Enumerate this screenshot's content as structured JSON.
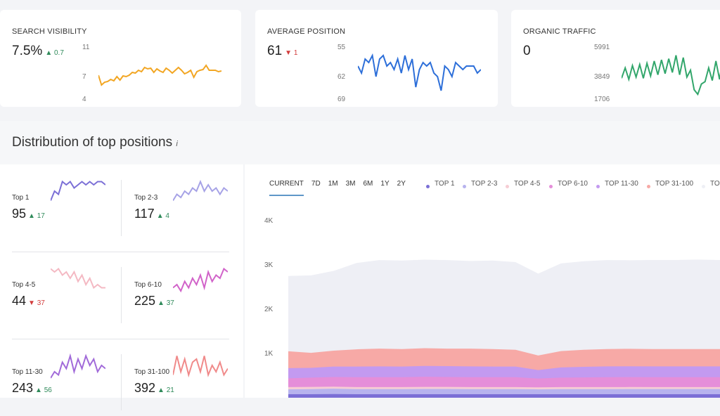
{
  "cards": [
    {
      "title": "SEARCH VISIBILITY",
      "value": "7.5%",
      "delta": "0.7",
      "dir": "up",
      "axis": [
        "11",
        "7",
        "4"
      ],
      "color": "#f2a623",
      "range": [
        4,
        11
      ],
      "values": [
        7.2,
        5.8,
        6.2,
        6.3,
        6.6,
        6.4,
        7.0,
        6.5,
        7.1,
        7.0,
        7.2,
        7.6,
        7.5,
        7.9,
        7.7,
        8.3,
        8.1,
        8.2,
        7.6,
        8.1,
        7.8,
        7.6,
        8.2,
        7.9,
        7.5,
        7.9,
        8.3,
        7.9,
        7.4,
        7.6,
        7.9,
        6.9,
        7.7,
        7.9,
        8.0,
        8.6,
        7.9,
        7.9,
        7.9,
        7.7,
        7.8
      ]
    },
    {
      "title": "AVERAGE POSITION",
      "value": "61",
      "delta": "1",
      "dir": "down",
      "axis": [
        "55",
        "62",
        "69"
      ],
      "color": "#2d6fd9",
      "range": [
        55,
        69
      ],
      "values": [
        60,
        62,
        58,
        59,
        57,
        63,
        58,
        57,
        60,
        59,
        61,
        58,
        62,
        57,
        61,
        58,
        66,
        61,
        59,
        60,
        59,
        62,
        63,
        67,
        60,
        61,
        63,
        59,
        60,
        61,
        60,
        60,
        60,
        62,
        61
      ]
    },
    {
      "title": "ORGANIC TRAFFIC",
      "value": "0",
      "axis": [
        "5991",
        "3849",
        "1706"
      ],
      "color": "#32a66b",
      "range": [
        1706,
        5991
      ],
      "values": [
        3400,
        4300,
        3300,
        4500,
        3500,
        4600,
        3400,
        4700,
        3600,
        4900,
        3700,
        5000,
        3800,
        5100,
        3900,
        5400,
        3700,
        5200,
        3500,
        4100,
        2400,
        2000,
        2900,
        3100,
        4300,
        3200,
        4900,
        3300,
        5200,
        3400,
        5300,
        3500
      ]
    }
  ],
  "section": {
    "title": "Distribution of top positions",
    "info": "i"
  },
  "tiles": [
    {
      "label": "Top 1",
      "value": "95",
      "delta": "17",
      "dir": "up",
      "color": "#7b6fd6",
      "values": [
        3,
        6,
        5,
        9,
        8,
        9,
        7,
        8,
        9,
        8,
        9,
        8,
        9,
        9,
        8
      ]
    },
    {
      "label": "Top 2-3",
      "value": "117",
      "delta": "4",
      "dir": "up",
      "color": "#a6a2e6",
      "values": [
        3,
        5,
        4,
        6,
        5,
        7,
        6,
        9,
        6,
        8,
        6,
        7,
        5,
        7,
        6
      ]
    },
    {
      "label": "Top 4-5",
      "value": "44",
      "delta": "37",
      "dir": "down",
      "color": "#f4b9c3",
      "values": [
        9,
        8,
        9,
        7,
        8,
        6,
        8,
        5,
        7,
        4,
        6,
        3,
        4,
        3,
        3
      ]
    },
    {
      "label": "Top 6-10",
      "value": "225",
      "delta": "37",
      "dir": "up",
      "color": "#d163c9",
      "values": [
        3,
        4,
        2,
        5,
        3,
        6,
        4,
        7,
        3,
        8,
        5,
        7,
        6,
        9,
        8
      ]
    },
    {
      "label": "Top 11-30",
      "value": "243",
      "delta": "56",
      "dir": "up",
      "color": "#a16ad9",
      "values": [
        2,
        4,
        3,
        7,
        5,
        9,
        4,
        8,
        5,
        9,
        6,
        8,
        4,
        6,
        5
      ]
    },
    {
      "label": "Top 31-100",
      "value": "392",
      "delta": "21",
      "dir": "up",
      "color": "#f08a8a",
      "values": [
        3,
        9,
        4,
        8,
        3,
        7,
        8,
        4,
        9,
        3,
        6,
        4,
        7,
        3,
        5
      ]
    }
  ],
  "tabs": [
    "CURRENT",
    "7D",
    "1M",
    "3M",
    "6M",
    "1Y",
    "2Y"
  ],
  "active_tab": "CURRENT",
  "chart_data": {
    "type": "area",
    "stacked": true,
    "yticks": [
      "4K",
      "3K",
      "2K",
      "1K"
    ],
    "ylim": [
      0,
      4000
    ],
    "series": [
      {
        "name": "TOP 1",
        "color": "#7b6fd6",
        "values": [
          95,
          95,
          100,
          95,
          95,
          95,
          95,
          95,
          95,
          95,
          95,
          95,
          95,
          95,
          95,
          95,
          95,
          95,
          95,
          95
        ]
      },
      {
        "name": "TOP 2-3",
        "color": "#b7b3ee",
        "values": [
          110,
          115,
          120,
          115,
          115,
          115,
          120,
          120,
          115,
          115,
          115,
          110,
          115,
          115,
          115,
          117,
          117,
          117,
          117,
          117
        ]
      },
      {
        "name": "TOP 4-5",
        "color": "#f6cdd4",
        "values": [
          50,
          50,
          45,
          45,
          45,
          45,
          45,
          45,
          45,
          45,
          45,
          45,
          45,
          45,
          45,
          45,
          44,
          44,
          44,
          44
        ]
      },
      {
        "name": "TOP 6-10",
        "color": "#e58ed9",
        "values": [
          200,
          210,
          220,
          225,
          225,
          225,
          230,
          225,
          225,
          225,
          225,
          200,
          215,
          220,
          225,
          225,
          225,
          225,
          225,
          225
        ]
      },
      {
        "name": "TOP 11-30",
        "color": "#c39af0",
        "values": [
          230,
          220,
          235,
          240,
          245,
          240,
          245,
          245,
          245,
          240,
          240,
          190,
          230,
          240,
          245,
          245,
          243,
          243,
          243,
          243
        ]
      },
      {
        "name": "TOP 31-100",
        "color": "#f7a9a6",
        "values": [
          380,
          340,
          360,
          390,
          400,
          395,
          400,
          395,
          400,
          395,
          380,
          330,
          370,
          385,
          390,
          395,
          392,
          392,
          392,
          392
        ]
      },
      {
        "name": "TO",
        "color": "#eeeff5",
        "values": [
          1700,
          1750,
          1800,
          1950,
          2000,
          2000,
          2000,
          2000,
          1980,
          2000,
          1980,
          1850,
          1980,
          2000,
          2010,
          2000,
          2010,
          2010,
          2020,
          2010
        ]
      }
    ]
  }
}
